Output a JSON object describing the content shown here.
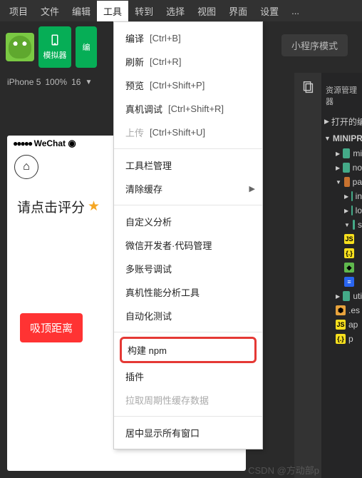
{
  "menubar": [
    "项目",
    "文件",
    "编辑",
    "工具",
    "转到",
    "选择",
    "视图",
    "界面",
    "设置",
    "..."
  ],
  "menubar_active_index": 3,
  "toolbar": {
    "simulator_label": "模拟器",
    "edit_label": "编",
    "mode_label": "小程序模式"
  },
  "device_row": {
    "device": "iPhone 5",
    "zoom": "100%",
    "font": "16"
  },
  "dropdown": {
    "compile": {
      "label": "编译",
      "shortcut": "[Ctrl+B]"
    },
    "refresh": {
      "label": "刷新",
      "shortcut": "[Ctrl+R]"
    },
    "preview": {
      "label": "预览",
      "shortcut": "[Ctrl+Shift+P]"
    },
    "realdebug": {
      "label": "真机调试",
      "shortcut": "[Ctrl+Shift+R]"
    },
    "upload": {
      "label": "上传",
      "shortcut": "[Ctrl+Shift+U]",
      "disabled": true
    },
    "toolbar_mgmt": {
      "label": "工具栏管理"
    },
    "clear_cache": {
      "label": "清除缓存",
      "submenu": true
    },
    "custom_analysis": {
      "label": "自定义分析"
    },
    "wechat_dev": {
      "label": "微信开发者·代码管理"
    },
    "multi_account": {
      "label": "多账号调试"
    },
    "perf_tool": {
      "label": "真机性能分析工具"
    },
    "auto_test": {
      "label": "自动化测试"
    },
    "build_npm": {
      "label": "构建 npm"
    },
    "plugins": {
      "label": "插件"
    },
    "pull_cache": {
      "label": "拉取周期性缓存数据",
      "disabled": true
    },
    "center_windows": {
      "label": "居中显示所有窗口"
    }
  },
  "simulator": {
    "wechat_label": "WeChat",
    "rating_text": "请点击评分",
    "sticky_label": "吸顶距离"
  },
  "vscode": {
    "explorer_title": "资源管理器",
    "open_editors": "打开的编辑",
    "project": "MINIPROC",
    "tree": [
      {
        "icon": "folder",
        "name": "mi",
        "depth": 1,
        "caret": "▶"
      },
      {
        "icon": "folder",
        "name": "no",
        "depth": 1,
        "caret": "▶"
      },
      {
        "icon": "folder-o",
        "name": "pa",
        "depth": 1,
        "caret": "▼"
      },
      {
        "icon": "folder",
        "name": "in",
        "depth": 2,
        "caret": "▶"
      },
      {
        "icon": "folder",
        "name": "lo",
        "depth": 2,
        "caret": "▶"
      },
      {
        "icon": "folder",
        "name": "s",
        "depth": 2,
        "caret": "▼"
      },
      {
        "icon": "js",
        "name": "",
        "depth": 2,
        "badge": "JS"
      },
      {
        "icon": "json",
        "name": "",
        "depth": 2,
        "badge": "{.}"
      },
      {
        "icon": "json2",
        "name": "",
        "depth": 2,
        "badge": "◆"
      },
      {
        "icon": "css",
        "name": "",
        "depth": 2,
        "badge": "≡"
      },
      {
        "icon": "folder",
        "name": "uti",
        "depth": 1,
        "caret": "▶"
      },
      {
        "icon": "cfg",
        "name": ".es",
        "depth": 1,
        "badge": "⬢"
      },
      {
        "icon": "js",
        "name": "ap",
        "depth": 1,
        "badge": "JS"
      },
      {
        "icon": "json",
        "name": "p",
        "depth": 1,
        "badge": "{.}"
      }
    ]
  },
  "watermark": "CSDN @方动部p"
}
